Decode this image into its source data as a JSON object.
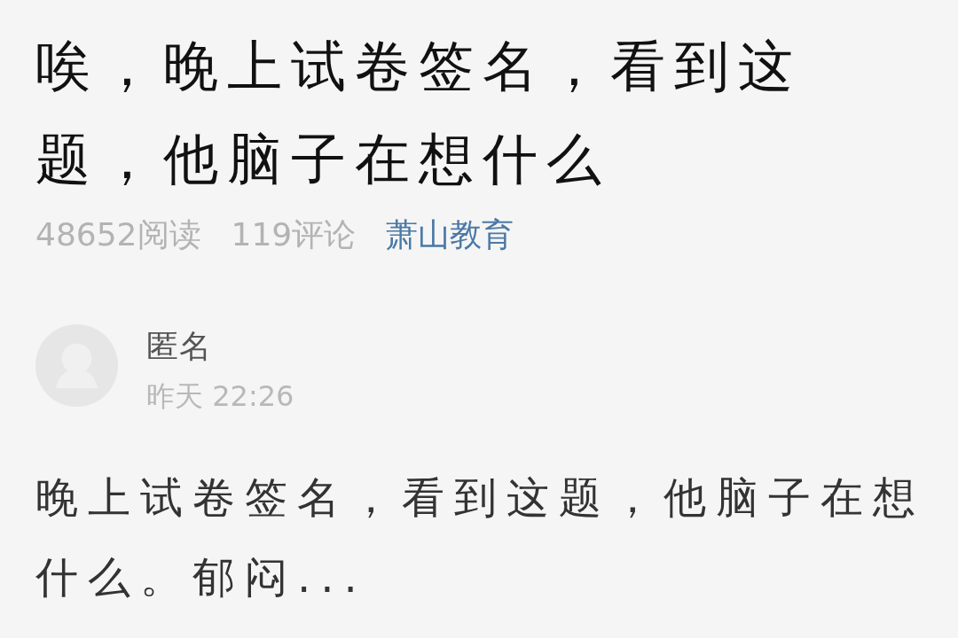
{
  "article": {
    "title": "唉，晚上试卷签名，看到这题，他脑子在想什么",
    "stats": [
      {
        "kind": "count",
        "text": "48652阅读"
      },
      {
        "kind": "count",
        "text": "119评论"
      },
      {
        "kind": "source",
        "text": "萧山教育"
      }
    ]
  },
  "comment": {
    "author": "匿名",
    "time": "昨天 22:26",
    "text": "晚上试卷签名，看到这题，他脑子在想什么。郁闷..."
  }
}
